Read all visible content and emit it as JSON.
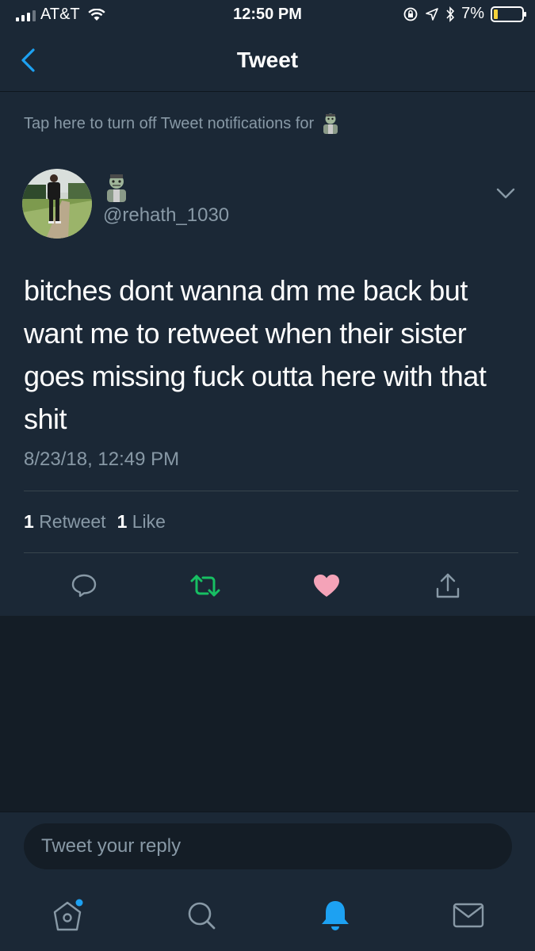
{
  "status_bar": {
    "carrier": "AT&T",
    "time": "12:50 PM",
    "battery_percent": "7%"
  },
  "nav": {
    "title": "Tweet",
    "back_icon": "chevron-left-icon"
  },
  "notification_banner": {
    "text": "Tap here to turn off Tweet notifications for"
  },
  "tweet": {
    "handle": "@rehath_1030",
    "text": "bitches dont wanna dm me back but want me to retweet when their sister goes missing fuck outta here with that shit",
    "timestamp": "8/23/18, 12:49 PM",
    "retweet_count": "1",
    "retweet_label": "Retweet",
    "like_count": "1",
    "like_label": "Like"
  },
  "actions": [
    {
      "icon": "reply-icon",
      "color": "#8899a6"
    },
    {
      "icon": "retweet-icon",
      "color": "#17bf63"
    },
    {
      "icon": "heart-icon",
      "color": "#e0245e"
    },
    {
      "icon": "share-icon",
      "color": "#8899a6"
    }
  ],
  "reply": {
    "placeholder": "Tweet your reply"
  },
  "tabbar": [
    {
      "icon": "home-icon",
      "active": false,
      "has_dot": true
    },
    {
      "icon": "search-icon",
      "active": false
    },
    {
      "icon": "bell-icon",
      "active": true
    },
    {
      "icon": "mail-icon",
      "active": false
    }
  ],
  "colors": {
    "background": "#141d26",
    "surface": "#1b2836",
    "accent": "#1da1f2",
    "secondary_text": "#8899a6",
    "retweet_green": "#17bf63",
    "like_pink": "#f4a3b8"
  }
}
